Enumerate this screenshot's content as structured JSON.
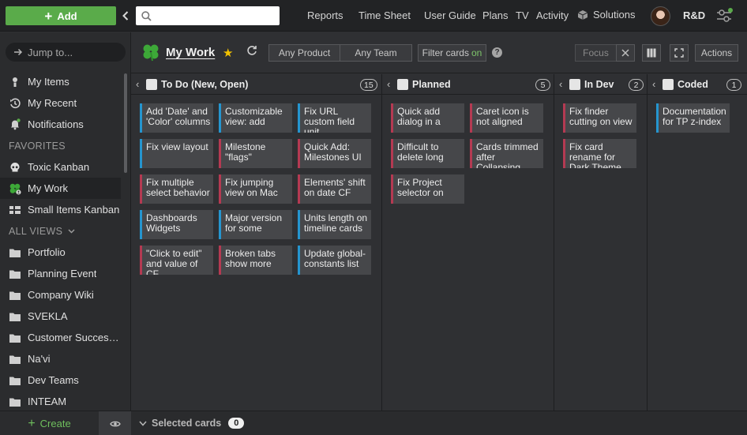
{
  "topbar": {
    "add_label": "Add",
    "search_placeholder": "",
    "nav": [
      "Reports",
      "Time Sheet",
      "User Guide",
      "Plans",
      "TV",
      "Activity",
      "Solutions"
    ],
    "team": "R&D"
  },
  "sidebar": {
    "jump_label": "Jump to...",
    "items": [
      {
        "label": "My Items",
        "icon": "person-icon"
      },
      {
        "label": "My Recent",
        "icon": "history-icon"
      },
      {
        "label": "Notifications",
        "icon": "bell-icon"
      }
    ],
    "favorites_heading": "FAVORITES",
    "favorites": [
      {
        "label": "Toxic Kanban",
        "icon": "skull-icon"
      },
      {
        "label": "My Work",
        "icon": "clover-icon",
        "active": true
      },
      {
        "label": "Small Items Kanban",
        "icon": "grid-icon"
      }
    ],
    "all_views_heading": "ALL VIEWS",
    "folders": [
      "Portfolio",
      "Planning Event",
      "Company Wiki",
      "SVEKLA",
      "Customer Success...",
      "Na'vi",
      "Dev Teams",
      "INTEAM"
    ],
    "create_label": "Create"
  },
  "header": {
    "title": "My Work",
    "any_product": "Any Product",
    "any_team": "Any Team",
    "filter_label": "Filter cards",
    "filter_state": "on",
    "focus_label": "Focus",
    "actions_label": "Actions"
  },
  "lanes": [
    {
      "name": "To Do (New, Open)",
      "count": "15",
      "cards": [
        {
          "text": "Add 'Date' and 'Color' columns",
          "type": "story"
        },
        {
          "text": "Customizable view: add",
          "type": "story"
        },
        {
          "text": "Fix URL custom field unit",
          "type": "story"
        },
        {
          "text": "Fix view layout",
          "type": "story"
        },
        {
          "text": "Milestone \"flags\"",
          "type": "bug"
        },
        {
          "text": "Quick Add: Milestones UI",
          "type": "bug"
        },
        {
          "text": "Fix multiple select behavior",
          "type": "bug"
        },
        {
          "text": "Fix jumping view on Mac",
          "type": "bug"
        },
        {
          "text": "Elements' shift on date CF",
          "type": "bug"
        },
        {
          "text": "Dashboards Widgets",
          "type": "story"
        },
        {
          "text": "Major version for some",
          "type": "story"
        },
        {
          "text": "Units length on timeline cards",
          "type": "story"
        },
        {
          "text": "\"Click to edit\" and value of CF",
          "type": "bug"
        },
        {
          "text": "Broken tabs show more",
          "type": "bug"
        },
        {
          "text": "Update global-constants list",
          "type": "story"
        }
      ]
    },
    {
      "name": "Planned",
      "count": "5",
      "cards": [
        {
          "text": "Quick add dialog in a",
          "type": "bug"
        },
        {
          "text": "Caret icon is not aligned",
          "type": "bug"
        },
        {
          "text": "Difficult to delete long",
          "type": "bug"
        },
        {
          "text": "Cards trimmed after Collapsing",
          "type": "bug"
        },
        {
          "text": "Fix Project selector on",
          "type": "bug"
        }
      ]
    },
    {
      "name": "In Dev",
      "count": "2",
      "cards": [
        {
          "text": "Fix finder cutting on view",
          "type": "bug"
        },
        {
          "text": "Fix card rename for Dark Theme",
          "type": "bug"
        }
      ]
    },
    {
      "name": "Coded",
      "count": "1",
      "cards": [
        {
          "text": "Documentation for TP z-index",
          "type": "story"
        }
      ]
    }
  ],
  "footer": {
    "label": "Selected cards",
    "count": "0"
  },
  "colors": {
    "accent_green": "#5aab4a",
    "story_bar": "#2595cf",
    "bug_bar": "#b43a52",
    "star": "#f2c200"
  }
}
